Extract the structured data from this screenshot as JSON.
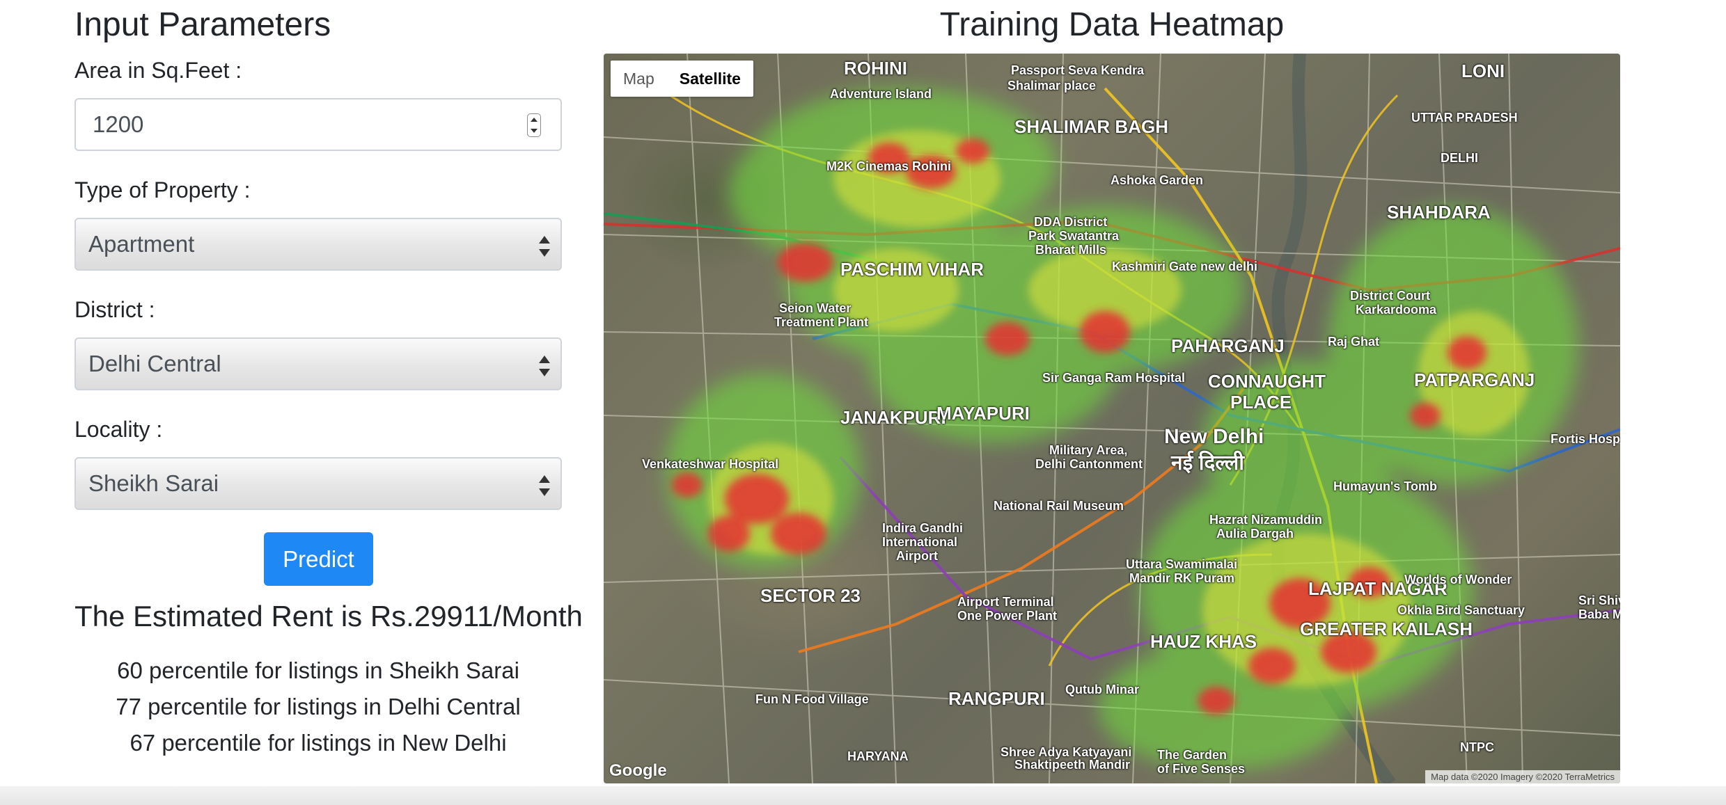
{
  "form": {
    "title": "Input Parameters",
    "area_label": "Area in Sq.Feet :",
    "area_value": "1200",
    "property_label": "Type of Property :",
    "property_value": "Apartment",
    "district_label": "District :",
    "district_value": "Delhi Central",
    "locality_label": "Locality :",
    "locality_value": "Sheikh Sarai",
    "predict_label": "Predict"
  },
  "result": {
    "estimate": "The Estimated Rent is Rs.29911/Month",
    "percentiles": [
      "60 percentile for listings in Sheikh Sarai",
      "77 percentile for listings in Delhi Central",
      "67 percentile for listings in New Delhi"
    ]
  },
  "map": {
    "title": "Training Data Heatmap",
    "toggle_map": "Map",
    "toggle_satellite": "Satellite",
    "google": "Google",
    "credit": "Map data ©2020 Imagery ©2020 TerraMetrics",
    "labels": {
      "rohini": "ROHINI",
      "shalimar_bagh": "SHALIMAR BAGH",
      "paschim_vihar": "PASCHIM VIHAR",
      "janakpuri": "JANAKPURI",
      "mayapuri": "MAYAPURI",
      "new_delhi": "New Delhi",
      "new_delhi_hi": "नई दिल्ली",
      "connaught": "CONNAUGHT",
      "place": "PLACE",
      "paharganj": "PAHARGANJ",
      "shahdara": "SHAHDARA",
      "patparganj": "PATPARGANJ",
      "lajpat_nagar": "LAJPAT NAGAR",
      "hauz_khas": "HAUZ KHAS",
      "greater_kailash": "GREATER KAILASH",
      "sector_23": "SECTOR 23",
      "rangpuri": "RANGPURI",
      "loni": "LONI",
      "uttar_pradesh": "UTTAR PRADESH",
      "delhi": "DELHI",
      "venkateshwar": "Venkateshwar Hospital",
      "indira_gandhi": "Indira Gandhi",
      "international": "International",
      "airport": "Airport",
      "military": "Military Area,",
      "delhi_cantonment": "Delhi Cantonment",
      "kashmiri_gate": "Kashmiri Gate new delhi",
      "sir_ganga": "Sir Ganga Ram Hospital",
      "humayuns": "Humayun's Tomb",
      "national_rail": "National Rail Museum",
      "worlds_of_wonder": "Worlds of Wonder",
      "okhla": "Okhla Bird Sanctuary",
      "qutub": "Qutub Minar",
      "fun_n_food": "Fun N Food Village",
      "seion_water": "Seion Water",
      "treatment_plant": "Treatment Plant",
      "adventure_island": "Adventure Island",
      "passport": "Passport Seva Kendra",
      "shalimar_place": "Shalimar place",
      "m2k": "M2K Cinemas Rohini",
      "ashoka_garden": "Ashoka Garden",
      "dda_district": "DDA District",
      "park_swatantra": "Park Swatantra",
      "bharat_mills": "Bharat Mills",
      "district_court": "District Court",
      "karkardooma": "Karkardooma",
      "raj_ghat": "Raj Ghat",
      "hazrat": "Hazrat Nizamuddin",
      "aulia_dargah": "Aulia Dargah",
      "uttara_swami": "Uttara Swamimalai",
      "mandir_rk": "Mandir RK Puram",
      "airport_terminal": "Airport Terminal",
      "one_power": "One Power Plant",
      "shree_adya": "Shree Adya Katyayani",
      "shaktipeeth": "Shaktipeeth Mandir",
      "garden_five": "The Garden",
      "of_five_senses": "of Five Senses",
      "ntpc": "NTPC",
      "fortis": "Fortis Hospital",
      "haryana": "HARYANA",
      "sri_shiv": "Sri Shiv",
      "baba_m": "Baba M"
    },
    "colors": {
      "heat_green": "#6fe23a",
      "heat_yellow": "#e2e63a",
      "heat_red": "#e53030",
      "metro_red": "#d4332f",
      "metro_yellow": "#f2c521",
      "metro_blue": "#2f68c7",
      "metro_orange": "#f07c1d",
      "metro_purple": "#8d3fb8",
      "metro_green": "#1a9b54"
    }
  }
}
